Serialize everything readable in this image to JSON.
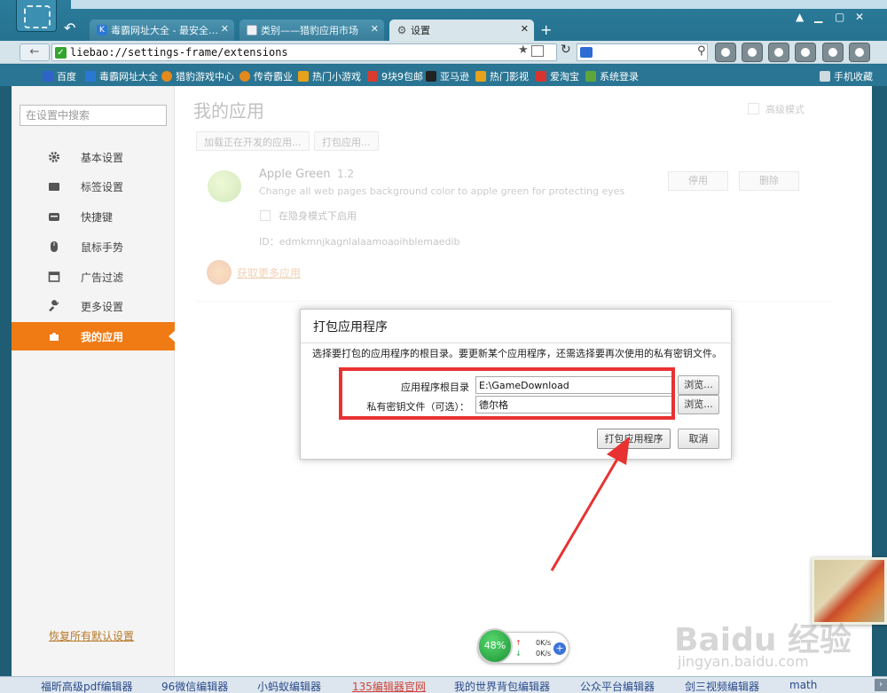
{
  "tabs": [
    {
      "title": "毒霸网址大全 - 最安全…",
      "icon": "K"
    },
    {
      "title": "类别——猎豹应用市场",
      "icon": ""
    },
    {
      "title": "设置",
      "icon": "⚙"
    }
  ],
  "new_tab_label": "+",
  "address": {
    "url": "liebao://settings-frame/extensions"
  },
  "bookmarks": [
    {
      "label": "百度",
      "color": "#2f63c8"
    },
    {
      "label": "毒霸网址大全",
      "color": "#2b78d3"
    },
    {
      "label": "猎豹游戏中心",
      "color": "#e38a1c"
    },
    {
      "label": "传奇霸业",
      "color": "#e38a1c"
    },
    {
      "label": "热门小游戏",
      "color": "#e6a21a"
    },
    {
      "label": "9块9包邮",
      "color": "#d83b2f"
    },
    {
      "label": "亚马逊",
      "color": "#222222"
    },
    {
      "label": "热门影视",
      "color": "#e6a21a"
    },
    {
      "label": "爱淘宝",
      "color": "#d8342f"
    },
    {
      "label": "系统登录",
      "color": "#5ea63a"
    }
  ],
  "bookmarks_right": "手机收藏",
  "sidebar": {
    "search_placeholder": "在设置中搜索",
    "items": [
      {
        "label": "基本设置",
        "icon": "gear-icon"
      },
      {
        "label": "标签设置",
        "icon": "tab-icon"
      },
      {
        "label": "快捷键",
        "icon": "keyboard-icon"
      },
      {
        "label": "鼠标手势",
        "icon": "mouse-icon"
      },
      {
        "label": "广告过滤",
        "icon": "window-icon"
      },
      {
        "label": "更多设置",
        "icon": "wrench-icon"
      },
      {
        "label": "我的应用",
        "icon": "puzzle-icon"
      }
    ],
    "restore_label": "恢复所有默认设置"
  },
  "content": {
    "title": "我的应用",
    "advanced_mode": "高级模式",
    "load_button": "加载正在开发的应用...",
    "pack_button": "打包应用...",
    "app": {
      "name": "Apple Green",
      "version": "1.2",
      "description": "Change all web pages background color to apple green for protecting eyes",
      "incognito_label": "在隐身模式下启用",
      "id": "ID：edmkmnjkagnlalaamoaoihblemaedib",
      "disable_label": "停用",
      "delete_label": "删除"
    },
    "get_more": "获取更多应用"
  },
  "dialog": {
    "title": "打包应用程序",
    "description": "选择要打包的应用程序的根目录。要更新某个应用程序，还需选择要再次使用的私有密钥文件。",
    "root_label": "应用程序根目录",
    "root_value": "E:\\GameDownload",
    "key_label": "私有密钥文件（可选）：",
    "key_value": "德尔格",
    "browse_label": "浏览...",
    "pack_label": "打包应用程序",
    "cancel_label": "取消"
  },
  "speed": {
    "percent": "48%",
    "up": "0K/s",
    "down": "0K/s"
  },
  "watermark": {
    "main": "Baidu 经验",
    "sub": "jingyan.baidu.com"
  },
  "bottom_items": [
    "福昕高级pdf编辑器",
    "96微信编辑器",
    "小蚂蚁编辑器",
    "135编辑器官网",
    "我的世界背包编辑器",
    "公众平台编辑器",
    "剑三视频编辑器",
    "math"
  ],
  "colors": {
    "accent": "#f07a13",
    "annotation": "#e83232",
    "chrome": "#2b7b9a"
  }
}
